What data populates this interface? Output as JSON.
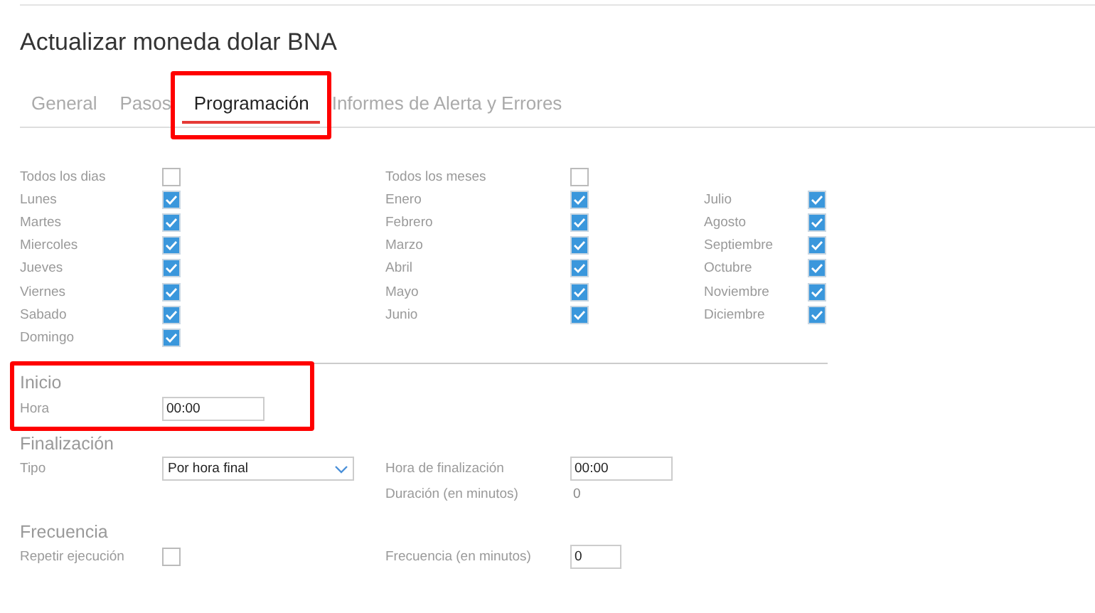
{
  "title": "Actualizar moneda dolar BNA",
  "tabs": [
    {
      "label": "General",
      "selected": false,
      "highlighted": false
    },
    {
      "label": "Pasos",
      "selected": false,
      "highlighted": false
    },
    {
      "label": "Programación",
      "selected": true,
      "highlighted": true
    },
    {
      "label": "Informes de Alerta y Errores",
      "selected": false,
      "highlighted": false
    }
  ],
  "days": {
    "all": {
      "label": "Todos los dias",
      "checked": false
    },
    "items": [
      {
        "label": "Lunes",
        "checked": true
      },
      {
        "label": "Martes",
        "checked": true
      },
      {
        "label": "Miercoles",
        "checked": true
      },
      {
        "label": "Jueves",
        "checked": true
      },
      {
        "label": "Viernes",
        "checked": true
      },
      {
        "label": "Sabado",
        "checked": true
      },
      {
        "label": "Domingo",
        "checked": true
      }
    ]
  },
  "months": {
    "all": {
      "label": "Todos los meses",
      "checked": false
    },
    "items": [
      {
        "label": "Enero",
        "checked": true
      },
      {
        "label": "Febrero",
        "checked": true
      },
      {
        "label": "Marzo",
        "checked": true
      },
      {
        "label": "Abril",
        "checked": true
      },
      {
        "label": "Mayo",
        "checked": true
      },
      {
        "label": "Junio",
        "checked": true
      },
      {
        "label": "Julio",
        "checked": true
      },
      {
        "label": "Agosto",
        "checked": true
      },
      {
        "label": "Septiembre",
        "checked": true
      },
      {
        "label": "Octubre",
        "checked": true
      },
      {
        "label": "Noviembre",
        "checked": true
      },
      {
        "label": "Diciembre",
        "checked": true
      }
    ]
  },
  "inicio": {
    "heading": "Inicio",
    "highlighted": true,
    "hora_label": "Hora",
    "hora_value": "00:00"
  },
  "finalizacion": {
    "heading": "Finalización",
    "tipo_label": "Tipo",
    "tipo_value": "Por hora final",
    "hora_fin_label": "Hora de finalización",
    "hora_fin_value": "00:00",
    "duracion_label": "Duración (en minutos)",
    "duracion_value": "0"
  },
  "frecuencia": {
    "heading": "Frecuencia",
    "repetir_label": "Repetir ejecución",
    "repetir_checked": false,
    "frecuencia_label": "Frecuencia (en minutos)",
    "frecuencia_value": "0"
  }
}
